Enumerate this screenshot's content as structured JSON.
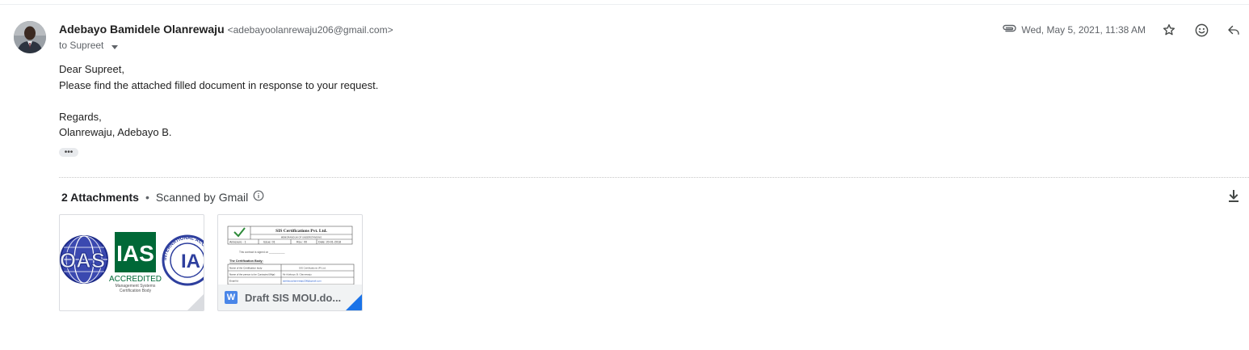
{
  "sender": {
    "name": "Adebayo Bamidele Olanrewaju",
    "email": "<adebayoolanrewaju206@gmail.com>"
  },
  "recipient": {
    "label": "to Supreet"
  },
  "meta": {
    "date": "Wed, May 5, 2021, 11:38 AM"
  },
  "icons": [
    "attachment-clip-icon",
    "star-icon",
    "emoji-reaction-icon",
    "reply-icon",
    "info-icon",
    "download-all-icon",
    "word-doc-icon"
  ],
  "body": {
    "lines": [
      "Dear Supreet,",
      "Please find the attached filled document in response to your request.",
      "",
      "Regards,",
      "Olanrewaju, Adebayo B."
    ],
    "trimmed_content_label": "•••"
  },
  "attachments": {
    "count_label": "2 Attachments",
    "separator": "•",
    "scanned_label": "Scanned by Gmail",
    "items": [
      {
        "type": "image",
        "logo_text": {
          "oas": "OAS",
          "ias": "IAS",
          "accredited": "ACCREDITED",
          "subtitle_1": "Management Systems",
          "subtitle_2": "Certification Body",
          "ring_text": "INTERNATIONAL ACCREDITATION",
          "ia": "IA"
        }
      },
      {
        "type": "word",
        "file_name": "Draft SIS MOU.do...",
        "word_badge": "W",
        "preview": {
          "company": "SIS Certifications Pvt. Ltd.",
          "form_title": "MEMORANDUM OF UNDERSTANDING",
          "annexure": "Annexure - 1",
          "issue": "Issue: 01",
          "rev": "Rev.: 00",
          "date": "Date: 20-01-2018",
          "contract_line": "This contract is signed on ___________",
          "section": "The Certification Body:",
          "row1_label": "Name of the Certification body",
          "row1_value": "SIS Certifications (P) Ltd.",
          "row2_label": "Name of the person to be Contacted (Mgr)",
          "row2_value": "Mr Adebayo B. Olanrewaju",
          "row3_label": "Email Id",
          "row3_value": "adebayoolanrewaju206@gmail.com"
        }
      }
    ]
  },
  "colors": {
    "text": "#202124",
    "muted": "#5f6368",
    "ias_green": "#006837",
    "accent_blue": "#1a73e8",
    "word_blue": "#4a86e8"
  }
}
